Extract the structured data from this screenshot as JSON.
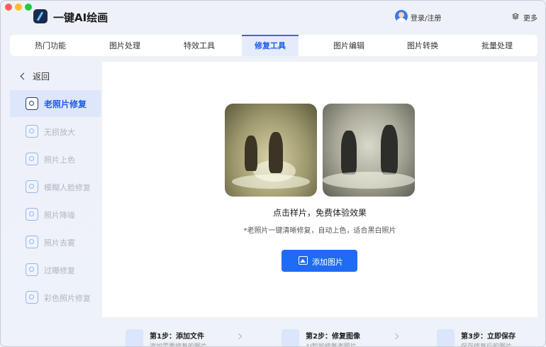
{
  "app": {
    "name": "一键AI绘画"
  },
  "header": {
    "login": "登录/注册",
    "more": "更多"
  },
  "tabs": [
    {
      "label": "热门功能"
    },
    {
      "label": "图片处理"
    },
    {
      "label": "特效工具"
    },
    {
      "label": "修复工具",
      "active": true
    },
    {
      "label": "图片编辑"
    },
    {
      "label": "图片转换"
    },
    {
      "label": "批量处理"
    }
  ],
  "sidebar": {
    "back": "返回",
    "items": [
      {
        "label": "老照片修复",
        "icon": "photo-restore-icon",
        "active": true
      },
      {
        "label": "无损放大",
        "icon": "enlarge-icon"
      },
      {
        "label": "照片上色",
        "icon": "palette-icon"
      },
      {
        "label": "模糊人脸修复",
        "icon": "face-icon"
      },
      {
        "label": "照片降噪",
        "icon": "denoise-icon"
      },
      {
        "label": "照片去雾",
        "icon": "dehaze-icon"
      },
      {
        "label": "过曝修复",
        "icon": "exposure-icon"
      },
      {
        "label": "彩色照片修复",
        "icon": "color-photo-icon"
      }
    ]
  },
  "main": {
    "cta_title": "点击样片，免费体验效果",
    "cta_sub": "*老照片一键清晰修复，自动上色，适合黑白照片",
    "add_button": "添加图片"
  },
  "steps": [
    {
      "title": "第1步：添加文件",
      "desc": "添加需要修复的图片"
    },
    {
      "title": "第2步：修复图像",
      "desc": "AI智能修复老照片"
    },
    {
      "title": "第3步：立即保存",
      "desc": "保存修复后的图片"
    }
  ],
  "colors": {
    "accent": "#1f6bf5",
    "active_bg": "#dde6fb",
    "window_bg": "#eef1f8"
  }
}
